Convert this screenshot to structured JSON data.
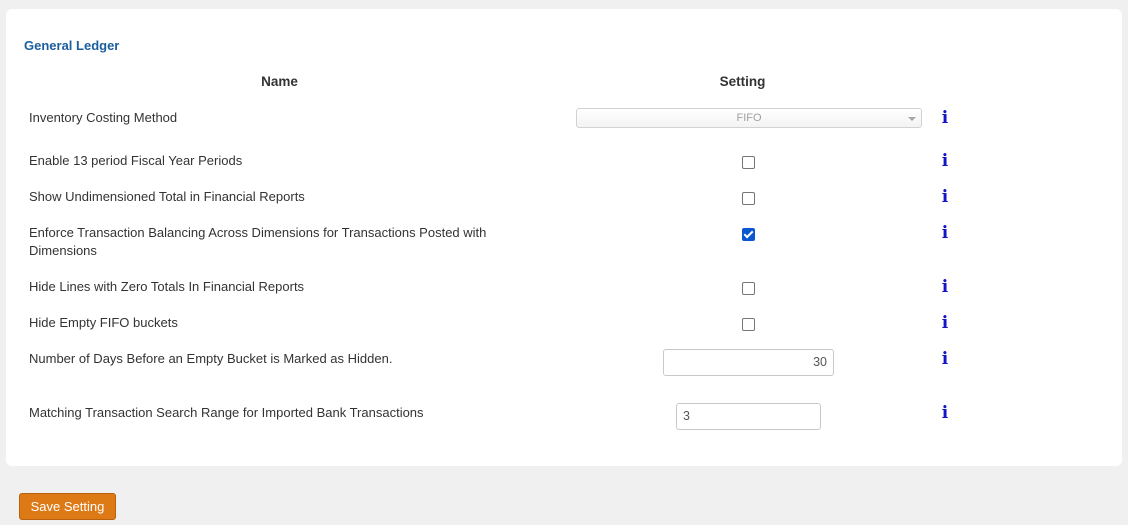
{
  "section_title": "General Ledger",
  "columns": {
    "name": "Name",
    "setting": "Setting"
  },
  "info_icon_glyph": "i",
  "settings": {
    "inventory_costing": {
      "label": "Inventory Costing Method",
      "value": "FIFO"
    },
    "thirteen_period": {
      "label": "Enable 13 period Fiscal Year Periods",
      "checked": false
    },
    "undimensioned_total": {
      "label": "Show Undimensioned Total in Financial Reports",
      "checked": false
    },
    "enforce_balancing": {
      "label": "Enforce Transaction Balancing Across Dimensions for Transactions Posted with Dimensions",
      "checked": true
    },
    "hide_zero_lines": {
      "label": "Hide Lines with Zero Totals In Financial Reports",
      "checked": false
    },
    "hide_empty_fifo": {
      "label": "Hide Empty FIFO buckets",
      "checked": false
    },
    "days_before_hidden": {
      "label": "Number of Days Before an Empty Bucket is Marked as Hidden.",
      "value": "30"
    },
    "matching_range": {
      "label": "Matching Transaction Search Range for Imported Bank Transactions",
      "value": "3"
    }
  },
  "save_button": "Save Setting",
  "colors": {
    "section_title": "#1b5e9e",
    "info_icon": "#1414c8",
    "save_button_bg": "#de7a16",
    "checkbox_checked": "#0b57d0",
    "panel_bg": "#ffffff",
    "page_bg": "#f0f0f0"
  }
}
